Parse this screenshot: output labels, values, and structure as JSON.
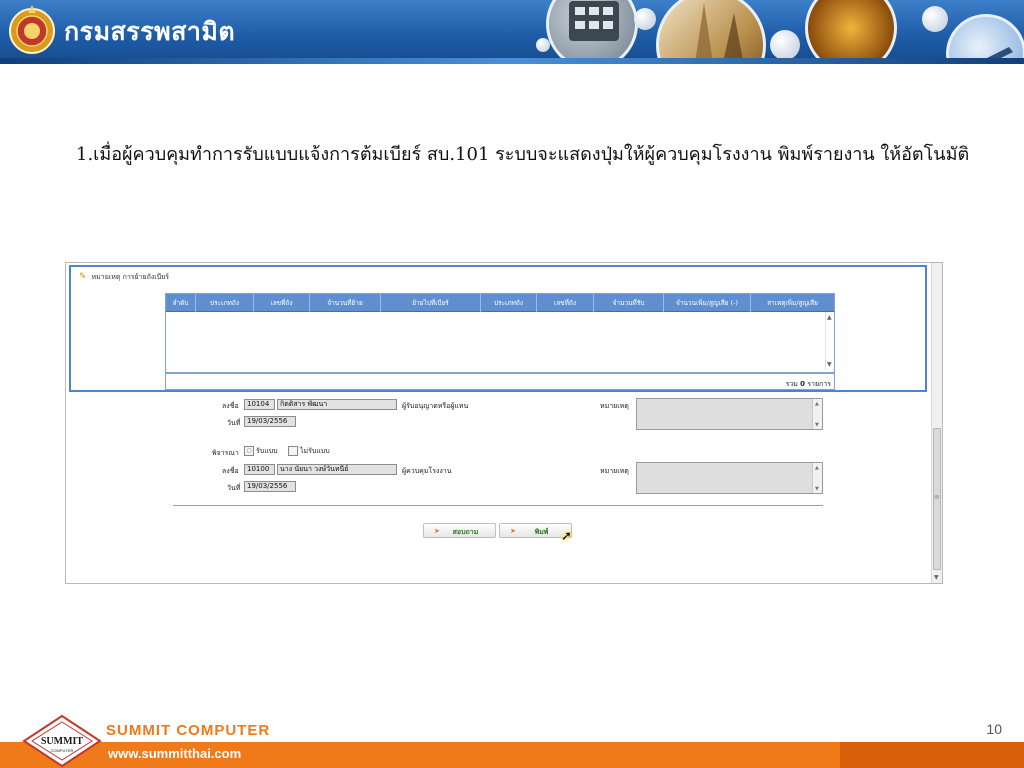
{
  "header": {
    "department": "กรมสรรพสามิต"
  },
  "description": "1.เมื่อผู้ควบคุมทำการรับแบบแจ้งการต้มเบียร์ สบ.101 ระบบจะแสดงปุ่มให้ผู้ควบคุมโรงงาน พิมพ์รายงาน ให้อัตโนมัติ",
  "panel": {
    "title": "หมายเหตุ การย้ายถังเบียร์"
  },
  "grid": {
    "columns": [
      "ลำดับ",
      "ประเภทถัง",
      "เลขที่ถัง",
      "จำนวนที่ย้าย",
      "ย้ายไปที่เบียร์",
      "ประเภทถัง",
      "เลขที่ถัง",
      "จำนวนที่รับ",
      "จำนวนเพิ่ม/สูญเสีย (-)",
      "สาเหตุเพิ่ม/สูญเสีย"
    ],
    "total_prefix": "รวม",
    "total_count": "0",
    "total_suffix": "รายการ"
  },
  "form": {
    "sign_label": "ลงชื่อ",
    "date_label": "วันที่",
    "remark_label": "หมายเหตุ",
    "requester": {
      "code": "10104",
      "name": "กิตติสาร พัฒนา",
      "role": "ผู้รับอนุญาตหรือผู้แทน",
      "date": "19/03/2556"
    },
    "consider_label": "พิจารณา",
    "accept_label": "รับแบบ",
    "reject_label": "ไม่รับแบบ",
    "controller": {
      "code": "10100",
      "name": "นาง นัยนา วงษ์วันทนีย์",
      "role": "ผู้ควบคุมโรงงาน",
      "date": "19/03/2556"
    }
  },
  "buttons": {
    "ask": "สอบถาม",
    "print": "พิมพ์"
  },
  "footer": {
    "page_number": "10",
    "company": "SUMMIT COMPUTER",
    "website": "www.summitthai.com",
    "logo_text": "SUMMIT",
    "logo_subtext": "COMPUTER"
  },
  "colors": {
    "header_blue": "#1f5da8",
    "panel_border": "#4e84c9",
    "grid_header": "#5f8fcf",
    "footer_orange": "#f07a1a",
    "button_text": "#2a7a1e"
  }
}
